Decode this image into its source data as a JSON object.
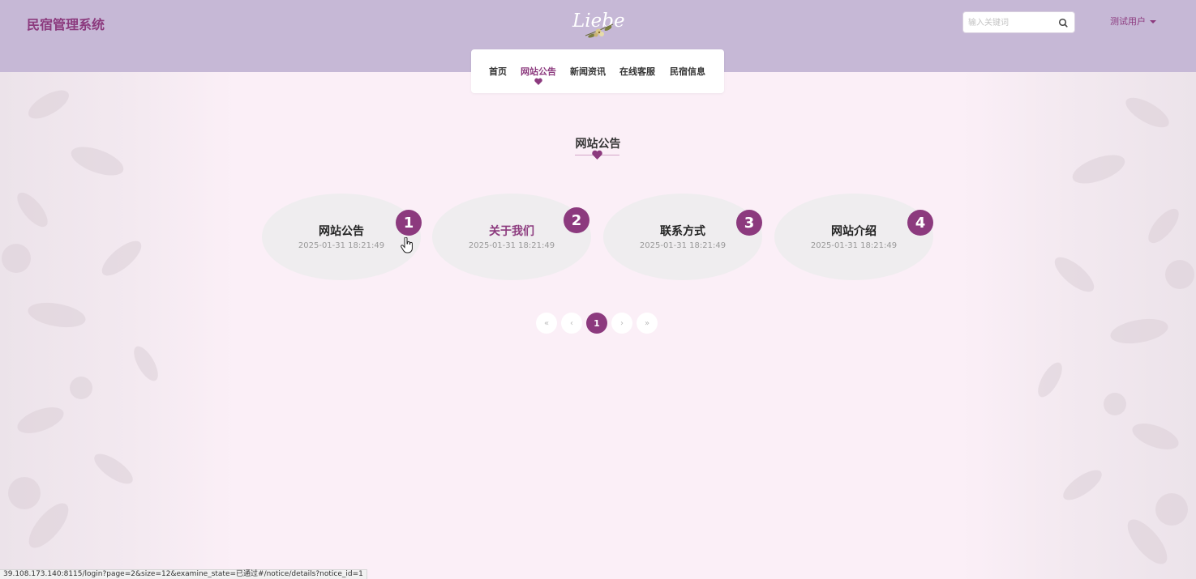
{
  "app": {
    "brand": "民宿管理系统",
    "logo_text": "Liebe"
  },
  "header": {
    "search": {
      "placeholder": "输入关键词",
      "value": ""
    },
    "user": {
      "label": "测试用户"
    }
  },
  "nav": {
    "items": [
      {
        "label": "首页"
      },
      {
        "label": "网站公告"
      },
      {
        "label": "新闻资讯"
      },
      {
        "label": "在线客服"
      },
      {
        "label": "民宿信息"
      }
    ],
    "active_index": 1
  },
  "section": {
    "title": "网站公告"
  },
  "notices": [
    {
      "number": "1",
      "title": "网站公告",
      "date": "2025-01-31 18:21:49"
    },
    {
      "number": "2",
      "title": "关于我们",
      "date": "2025-01-31 18:21:49"
    },
    {
      "number": "3",
      "title": "联系方式",
      "date": "2025-01-31 18:21:49"
    },
    {
      "number": "4",
      "title": "网站介绍",
      "date": "2025-01-31 18:21:49"
    }
  ],
  "pagination": {
    "first": "«",
    "prev": "‹",
    "current": "1",
    "next": "›",
    "last": "»"
  },
  "status_bar": {
    "url": "39.108.173.140:8115/login?page=2&size=12&examine_state=已通过#/notice/details?notice_id=1"
  },
  "colors": {
    "accent": "#8c3a7e",
    "header_bg": "#c6b8d6",
    "page_bg": "#fbeff7",
    "card_bg": "#efedef"
  }
}
